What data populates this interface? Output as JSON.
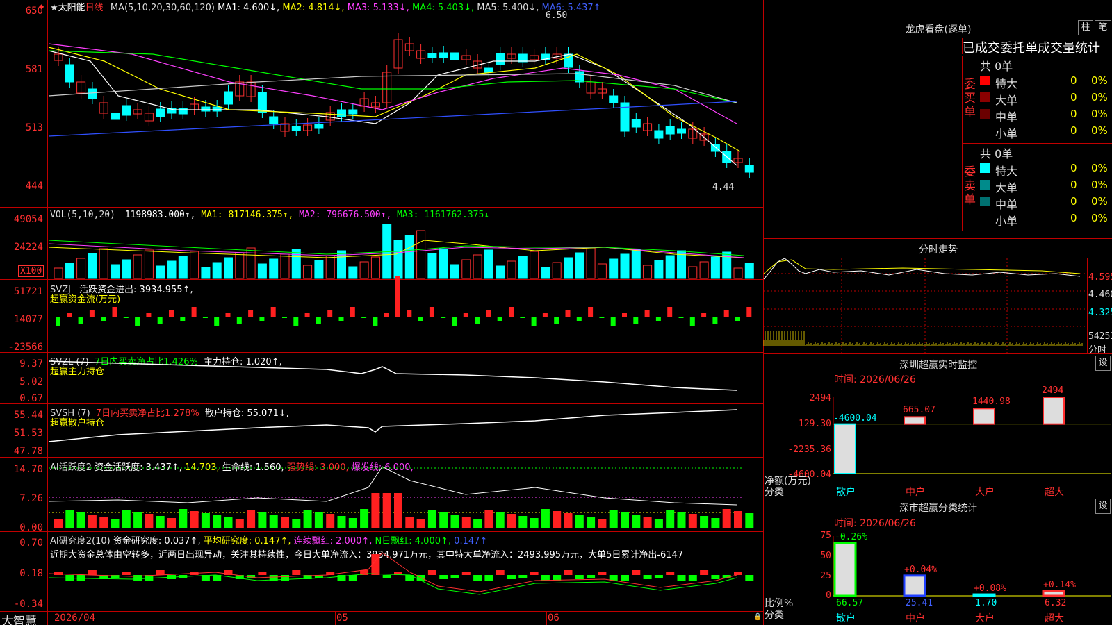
{
  "header": {
    "star": "★",
    "stock_name": "太阳能",
    "period": "日线",
    "ma_label": "MA(5,10,20,30,60,120)",
    "ma1": "MA1: 4.600↓,",
    "ma2": "MA2: 4.814↓,",
    "ma3": "MA3: 5.133↓,",
    "ma4": "MA4: 5.403↓,",
    "ma5": "MA5: 5.400↓,",
    "ma6": "MA6: 5.437↑"
  },
  "price_axis": [
    "650",
    "581",
    "513",
    "444"
  ],
  "price_annotations": {
    "high": "6.50",
    "low": "4.44"
  },
  "volume": {
    "title": "VOL(5,10,20)",
    "value": "1198983.000↑,",
    "ma1": "MA1: 817146.375↑,",
    "ma2": "MA2: 796676.500↑,",
    "ma3": "MA3: 1161762.375↓",
    "axis": [
      "49054",
      "24224"
    ],
    "unit": "X100"
  },
  "svzj": {
    "title": "SVZJ",
    "line1": "活跃资金进出: 3934.955↑,",
    "line2": "超赢资金流(万元)",
    "axis": [
      "51721",
      "14077",
      "-23566"
    ]
  },
  "svzl": {
    "title": "SVZL (7)",
    "line1": "7日内买卖净占比1.426%",
    "line2": "主力持仓: 1.020↑,",
    "line3": "超赢主力持仓",
    "axis": [
      "9.37",
      "5.02",
      "0.67"
    ]
  },
  "svsh": {
    "title": "SVSH (7)",
    "line1": "7日内买卖净占比1.278%",
    "line2": "散户持仓: 55.071↓,",
    "line3": "超赢散户持仓",
    "axis": [
      "55.44",
      "51.53",
      "47.78"
    ]
  },
  "ai1": {
    "title": "AI活跃度2",
    "p1": "资金活跃度: 3.437↑,",
    "p2": "14.703,",
    "p3": "生命线: 1.560,",
    "p4": "强势线: 3.000,",
    "p5": "爆发线: 6.000,",
    "axis": [
      "14.70",
      "7.26",
      "0.00"
    ]
  },
  "ai2": {
    "title": "AI研究度2(10)",
    "p1": "资金研究度: 0.037↑,",
    "p2": "平均研究度: 0.147↑,",
    "p3": "连续飘红: 2.000↑,",
    "p4": "N日飘红: 4.000↑,",
    "p5": "0.147↑",
    "note": "近期大资金总体由空转多，近两日出现异动，关注其持续性，今日大单净流入：3934.971万元，其中特大单净流入：2493.995万元，大单5日累计净出-6147",
    "axis": [
      "0.70",
      "0.18",
      "-0.34"
    ]
  },
  "date_axis": {
    "d1": "2026/04",
    "d2": "05",
    "d3": "06"
  },
  "brand": "大智慧",
  "lhb": {
    "title": "龙虎看盘(逐单)",
    "btn1": "柱",
    "btn2": "笔",
    "tab_header": "已成交委托单成交量统计",
    "buy_side": "委买单",
    "sell_side": "委卖单",
    "buy_total": "共 0单",
    "sell_total": "共 0单",
    "rows": [
      {
        "label": "特大",
        "val": "0",
        "pct": "0%"
      },
      {
        "label": "大单",
        "val": "0",
        "pct": "0%"
      },
      {
        "label": "中单",
        "val": "0",
        "pct": "0%"
      },
      {
        "label": "小单",
        "val": "0",
        "pct": "0%"
      }
    ],
    "buy_colors": [
      "#ff0000",
      "#8b0000",
      "#6b0000",
      "#000000"
    ],
    "sell_colors": [
      "#00ffff",
      "#008b8b",
      "#007070",
      "#000000"
    ]
  },
  "fenshi": {
    "title": "分时走势",
    "axis": [
      "4.595",
      "4.460",
      "4.325",
      "54251"
    ],
    "unit": "分时"
  },
  "sz_monitor": {
    "title": "深圳超赢实时监控",
    "btn": "设",
    "time": "时间: 2026/06/26",
    "axis": [
      "2494",
      "129.30",
      "-2235.36",
      "-4600.04"
    ],
    "ylabel1": "净额(万元)",
    "ylabel2": "分类",
    "cats": [
      "散户",
      "中户",
      "大户",
      "超大"
    ],
    "bar_labels": [
      "-4600.04",
      "665.07",
      "1440.98",
      "2494"
    ]
  },
  "sz_class": {
    "title": "深市超赢分类统计",
    "btn": "设",
    "time": "时间: 2026/06/26",
    "axis": [
      "75",
      "50",
      "25",
      "0"
    ],
    "ylabel1": "比例%",
    "ylabel2": "分类",
    "cats": [
      "散户",
      "中户",
      "大户",
      "超大"
    ],
    "changes": [
      "-0.26%",
      "+0.04%",
      "+0.08%",
      "+0.14%"
    ],
    "values": [
      "66.57",
      "25.41",
      "1.70",
      "6.32"
    ]
  },
  "chart_data": [
    {
      "type": "bar",
      "title": "深圳超赢实时监控",
      "categories": [
        "散户",
        "中户",
        "大户",
        "超大"
      ],
      "values": [
        -4600.04,
        665.07,
        1440.98,
        2494
      ],
      "ylabel": "净额(万元)",
      "ylim": [
        -4600.04,
        2494
      ]
    },
    {
      "type": "bar",
      "title": "深市超赢分类统计",
      "categories": [
        "散户",
        "中户",
        "大户",
        "超大"
      ],
      "values": [
        66.57,
        25.41,
        1.7,
        6.32
      ],
      "ylabel": "比例%",
      "ylim": [
        0,
        75
      ]
    }
  ]
}
